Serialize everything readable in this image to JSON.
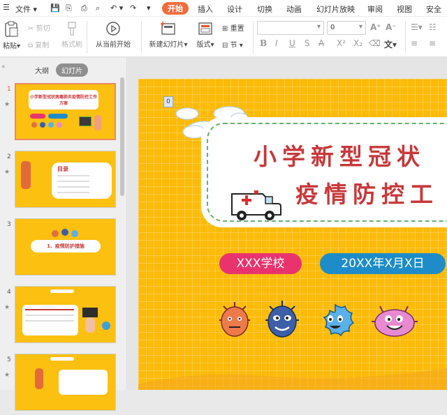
{
  "menubar": {
    "file_label": "文件",
    "tabs": [
      "开始",
      "插入",
      "设计",
      "切换",
      "动画",
      "幻灯片放映",
      "审阅",
      "视图",
      "安全"
    ],
    "active_tab": "开始"
  },
  "ribbon": {
    "paste": "粘贴",
    "cut": "剪切",
    "copy": "复制",
    "format_painter": "格式刷",
    "play_from_current": "从当前开始",
    "new_slide": "新建幻灯片",
    "layout": "版式",
    "reset": "重置",
    "section": "节",
    "font_size_value": "0",
    "underline_glyph": "U",
    "strike_glyph": "S"
  },
  "sidebar": {
    "tabs": [
      "大纲",
      "幻灯片"
    ],
    "active_tab": "幻灯片",
    "slide_numbers": [
      "1",
      "2",
      "3",
      "4",
      "5"
    ],
    "selected_slide": "1",
    "thumb1_title": "小学新型冠状病毒肺炎疫情防控工作方案",
    "thumb2_heading": "目录",
    "thumb3_heading": "1、疫情防护措施"
  },
  "slide": {
    "page_badge": "0",
    "title_line1": "小学新型冠状",
    "title_line2": "疫情防控工",
    "school_label": "XXX学校",
    "date_label": "20XX年X月X日"
  },
  "colors": {
    "accent": "#f26b3a",
    "slide_bg": "#fcbb09",
    "title_red": "#c8383a",
    "school_pill": "#e8336e",
    "date_pill": "#1e8cc8",
    "dash_green": "#64b36a"
  }
}
